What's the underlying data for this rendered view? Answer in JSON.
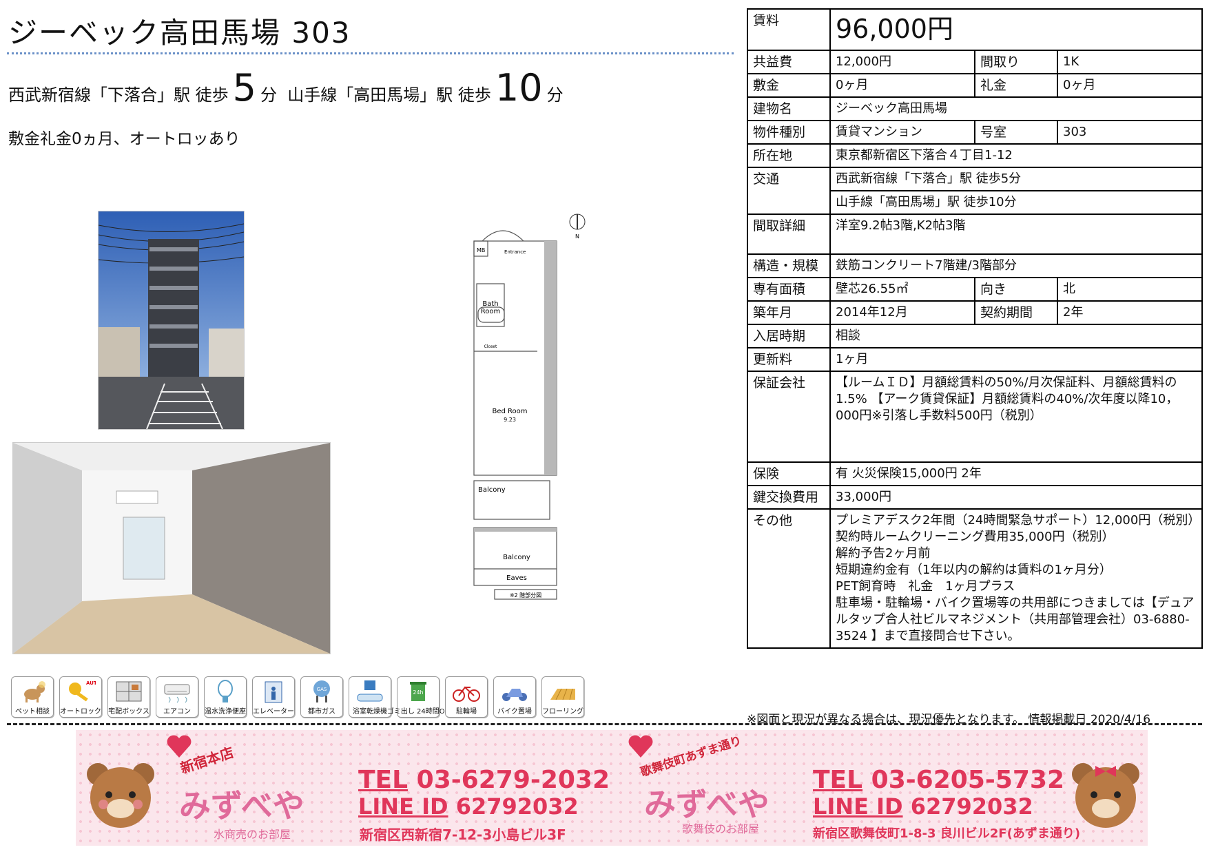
{
  "header": {
    "title": "ジーベック高田馬場 303",
    "access_line": {
      "line1": "西武新宿線「下落合」駅 徒歩",
      "walk1": "5",
      "unit1": "分",
      "line2": "山手線「高田馬場」駅 徒歩",
      "walk2": "10",
      "unit2": "分"
    },
    "catch_copy": "敷金礼金0ヵ月、オートロッあり"
  },
  "floorplan": {
    "labels": {
      "mb": "MB",
      "entrance": "Entrance",
      "bath": "Bath",
      "room": "Room",
      "closet": "Closet",
      "bedroom": "Bed Room",
      "bedroom_size": "9.23",
      "balcony": "Balcony",
      "balcony2": "Balcony",
      "eaves": "Eaves",
      "note": "※2 階部分図",
      "north": "N"
    }
  },
  "amenities": [
    {
      "label": "ペット相談",
      "icon": "dog-icon"
    },
    {
      "label": "オートロック",
      "icon": "key-icon",
      "badge": "AUTO"
    },
    {
      "label": "宅配ボックス",
      "icon": "lockers-icon"
    },
    {
      "label": "エアコン",
      "icon": "air-conditioner-icon"
    },
    {
      "label": "温水洗浄便座",
      "icon": "toilet-icon"
    },
    {
      "label": "エレベーター",
      "icon": "elevator-icon"
    },
    {
      "label": "都市ガス",
      "icon": "gas-tank-icon",
      "badge": "GAS"
    },
    {
      "label": "浴室乾燥機",
      "icon": "bath-dryer-icon"
    },
    {
      "label": "ゴミ出し 24時間OK",
      "icon": "trash-24h-icon",
      "badge": "24h"
    },
    {
      "label": "駐輪場",
      "icon": "bicycle-icon"
    },
    {
      "label": "バイク置場",
      "icon": "motorbike-icon"
    },
    {
      "label": "フローリング",
      "icon": "flooring-icon"
    }
  ],
  "spec": {
    "rent_label": "賃料",
    "rent": "96,000円",
    "common_fee_label": "共益費",
    "common_fee": "12,000円",
    "layout_label": "間取り",
    "layout": "1K",
    "deposit_label": "敷金",
    "deposit": "0ヶ月",
    "key_money_label": "礼金",
    "key_money": "0ヶ月",
    "building_name_label": "建物名",
    "building_name": "ジーベック高田馬場",
    "property_type_label": "物件種別",
    "property_type": "賃貸マンション",
    "room_no_label": "号室",
    "room_no": "303",
    "address_label": "所在地",
    "address": "東京都新宿区下落合４丁目1-12",
    "transport_label": "交通",
    "transport1": "西武新宿線「下落合」駅 徒歩5分",
    "transport2": "山手線「高田馬場」駅 徒歩10分",
    "layout_detail_label": "間取詳細",
    "layout_detail": "洋室9.2帖3階,K2帖3階",
    "structure_label": "構造・規模",
    "structure": "鉄筋コンクリート7階建/3階部分",
    "area_label": "専有面積",
    "area": "壁芯26.55㎡",
    "direction_label": "向き",
    "direction": "北",
    "built_label": "築年月",
    "built": "2014年12月",
    "contract_term_label": "契約期間",
    "contract_term": "2年",
    "move_in_label": "入居時期",
    "move_in": "相談",
    "renewal_label": "更新料",
    "renewal": "1ヶ月",
    "guarantor_label": "保証会社",
    "guarantor": "【ルームＩＤ】月額総賃料の50%/月次保証料、月額総賃料の1.5% 【アーク賃貸保証】月額総賃料の40%/次年度以降10，000円※引落し手数料500円（税別）",
    "insurance_label": "保険",
    "insurance": "有 火災保険15,000円 2年",
    "key_exchange_label": "鍵交換費用",
    "key_exchange": "33,000円",
    "other_label": "その他",
    "other": [
      "プレミアデスク2年間（24時間緊急サポート）12,000円（税別）",
      "契約時ルームクリーニング費用35,000円（税別）",
      "解約予告2ヶ月前",
      "短期違約金有（1年以内の解約は賃料の1ヶ月分）",
      "PET飼育時　礼金　1ヶ月プラス",
      "駐車場・駐輪場・バイク置場等の共用部につきましては【デュアルタップ合人社ビルマネジメント（共用部管理会社）03-6880-3524 】まで直接問合せ下さい。"
    ]
  },
  "footnote": "※図面と現況が異なる場合は、現況優先となります。 情報掲載日 2020/4/16",
  "banner": {
    "left": {
      "tag": "新宿本店",
      "logo": "みずべや",
      "sub": "水商売のお部屋",
      "tel_label": "TEL",
      "tel": "03-6279-2032",
      "line_label": "LINE ID",
      "line_id": "62792032",
      "address": "新宿区西新宿7-12-3小島ビル3F"
    },
    "right": {
      "tag": "歌舞伎町あずま通り",
      "logo": "みずべや",
      "sub": "歌舞伎のお部屋",
      "tel_label": "TEL",
      "tel": "03-6205-5732",
      "line_label": "LINE ID",
      "line_id": "62792032",
      "address": "新宿区歌舞伎町1-8-3 良川ビル2F(あずま通り)"
    },
    "colors": {
      "accent": "#e0365a",
      "pink": "#fbe6ec"
    }
  }
}
